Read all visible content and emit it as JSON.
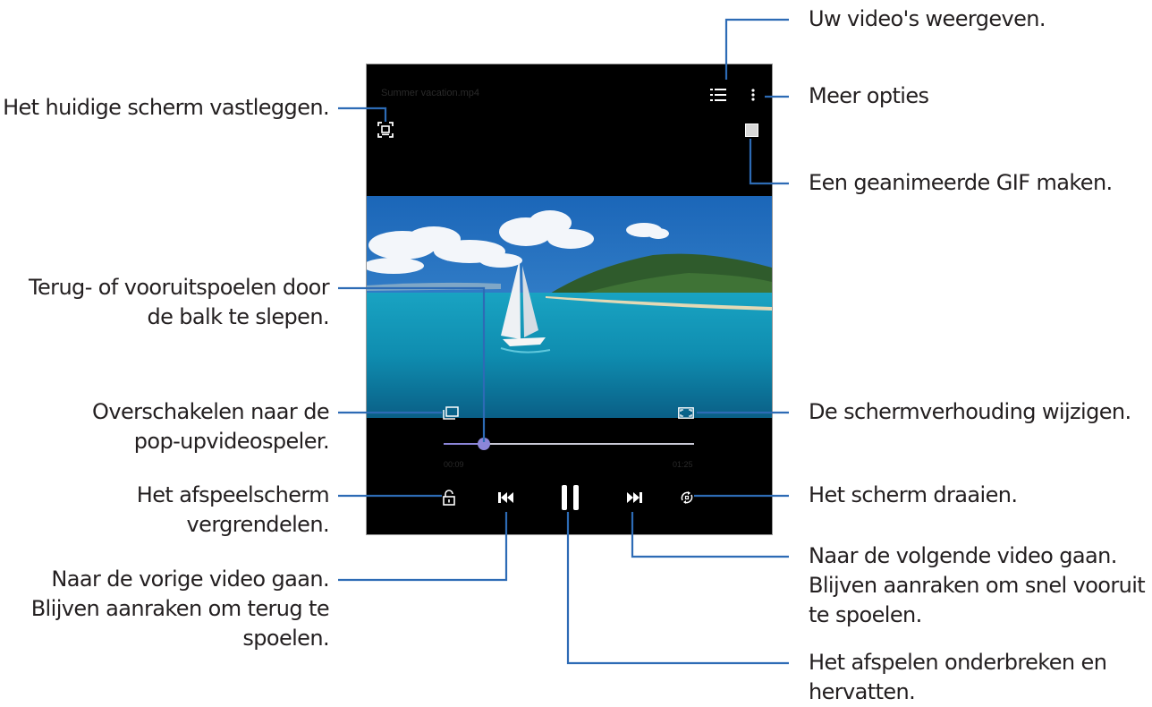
{
  "player": {
    "filename": "Summer vacation.mp4",
    "time_current": "00:09",
    "time_total": "01:25",
    "progress": 0.16
  },
  "callouts": {
    "view_videos": [
      "Uw video's weergeven."
    ],
    "more_options": [
      "Meer opties"
    ],
    "capture": [
      "Het huidige scherm vastleggen."
    ],
    "gif": [
      "Een geanimeerde GIF maken."
    ],
    "seek": [
      "Terug- of vooruitspoelen door",
      "de balk te slepen."
    ],
    "popup": [
      "Overschakelen naar de",
      "pop-upvideospeler."
    ],
    "ratio": [
      "De schermverhouding wijzigen."
    ],
    "lock": [
      "Het afspeelscherm",
      "vergrendelen."
    ],
    "rotate": [
      "Het scherm draaien."
    ],
    "previous": [
      "Naar de vorige video gaan.",
      "Blijven aanraken om terug te",
      "spoelen."
    ],
    "next": [
      "Naar de volgende video gaan.",
      "Blijven aanraken om snel vooruit",
      "te spoelen."
    ],
    "pause": [
      "Het afspelen onderbreken en",
      "hervatten."
    ]
  },
  "colors": {
    "leader": "#2d6bb5",
    "seek": "#8c86d9",
    "phone": "#000000"
  }
}
